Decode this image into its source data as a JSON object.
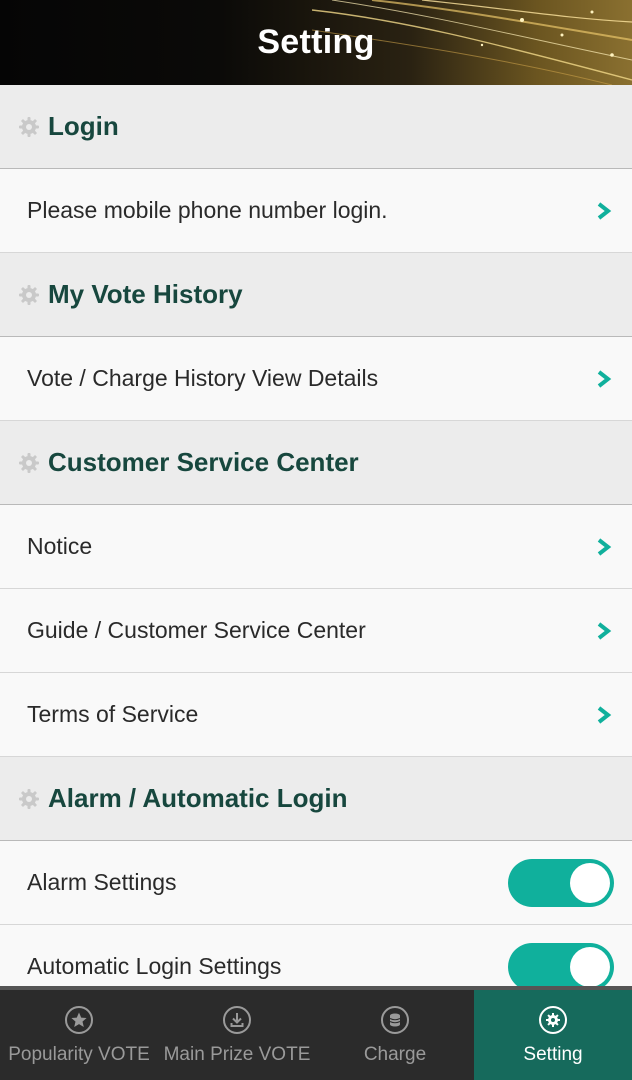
{
  "header": {
    "title": "Setting"
  },
  "sections": [
    {
      "title": "Login",
      "items": [
        {
          "label": "Please mobile phone number login.",
          "type": "link"
        }
      ]
    },
    {
      "title": "My Vote History",
      "items": [
        {
          "label": "Vote / Charge History View Details",
          "type": "link"
        }
      ]
    },
    {
      "title": "Customer Service Center",
      "items": [
        {
          "label": "Notice",
          "type": "link"
        },
        {
          "label": "Guide / Customer Service Center",
          "type": "link"
        },
        {
          "label": "Terms of Service",
          "type": "link"
        }
      ]
    },
    {
      "title": "Alarm / Automatic Login",
      "items": [
        {
          "label": "Alarm Settings",
          "type": "toggle",
          "on": true
        },
        {
          "label": "Automatic Login Settings",
          "type": "toggle",
          "on": true
        }
      ]
    }
  ],
  "tabbar": {
    "tabs": [
      {
        "label": "Popularity VOTE",
        "icon": "star-icon",
        "active": false
      },
      {
        "label": "Main Prize VOTE",
        "icon": "download-icon",
        "active": false
      },
      {
        "label": "Charge",
        "icon": "coin-stack-icon",
        "active": false
      },
      {
        "label": "Setting",
        "icon": "gear-icon",
        "active": true
      }
    ]
  },
  "colors": {
    "accent": "#10b09c",
    "section_title": "#17473e",
    "active_tab": "#166a5c",
    "tabbar_bg": "#2b2b2b"
  }
}
